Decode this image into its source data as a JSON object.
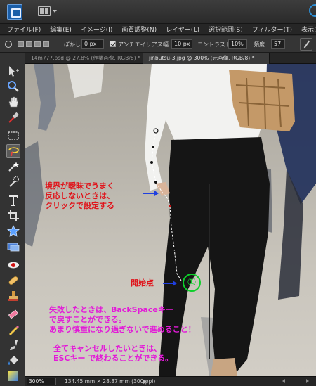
{
  "menu": [
    "ファイル(F)",
    "編集(E)",
    "イメージ(I)",
    "画質調整(N)",
    "レイヤー(L)",
    "選択範囲(S)",
    "フィルター(T)",
    "表示(V)"
  ],
  "options": {
    "feather_label": "ぼかし :",
    "feather_value": "0 px",
    "antialias_label": "アンチエイリアス",
    "width_value": "10 px",
    "contrast_label": "コントラスト :",
    "contrast_value": "10%",
    "frequency_label": "頻度 :",
    "frequency_value": "57"
  },
  "tabs": [
    {
      "label": "14m777.psd @ 27.8% (作業画像, RGB/8) *"
    },
    {
      "label": "jinbutsu-3.jpg @ 300% (元画像, RGB/8) *"
    }
  ],
  "annotations": {
    "hint1": [
      "境界が曖昧でうまく",
      "反応しないときは、",
      "クリックで設定する"
    ],
    "start": "開始点",
    "circle_number": "①",
    "hint2": [
      "失敗したときは、BackSpaceキー",
      "で戻すことができる。",
      "あまり慎重になり過ぎないで進めること！"
    ],
    "hint3": [
      "全てキャンセルしたいときは、",
      "ESCキー で終わることができる。"
    ]
  },
  "status": {
    "zoom": "300%",
    "doc_info": "134.45 mm × 28.87 mm (300 ppi)"
  },
  "colors": {
    "annot_red": "#e0141b",
    "annot_magenta": "#e31ad8",
    "marker_green": "#0dcf2a",
    "arrow_blue": "#1f3fe0"
  }
}
